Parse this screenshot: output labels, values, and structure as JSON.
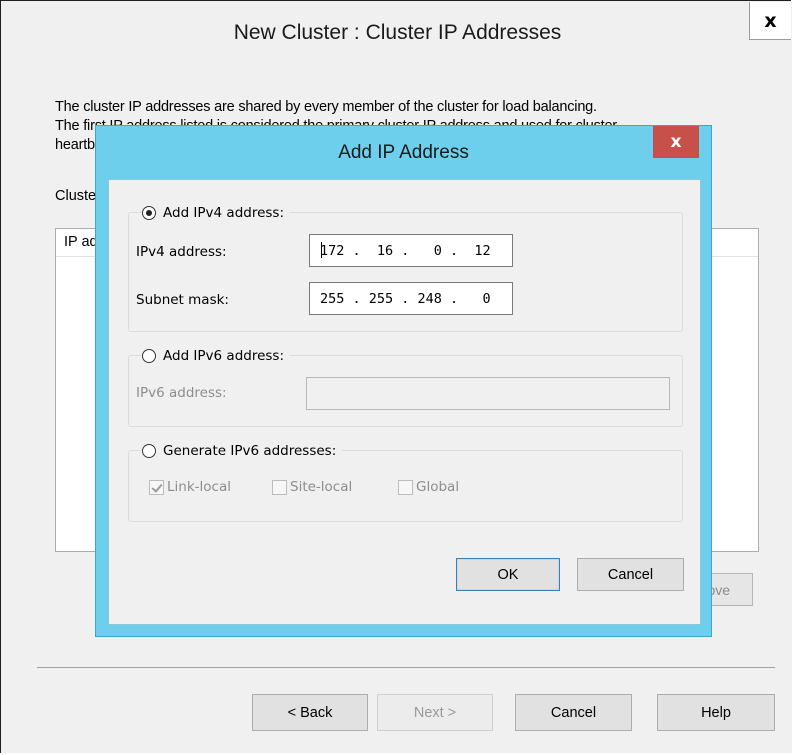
{
  "wizard": {
    "title": "New Cluster : Cluster IP Addresses",
    "close_glyph": "x",
    "description_lines": [
      "The cluster IP addresses are shared by every member of the cluster for load balancing.",
      "The first IP address listed is considered the primary cluster IP address and used for cluster",
      "heartbeats."
    ],
    "cluster_label": "Cluster IP addresses:",
    "list_column": "IP address",
    "remove_button": "Remove",
    "buttons": {
      "back": "< Back",
      "next": "Next >",
      "cancel": "Cancel",
      "help": "Help"
    }
  },
  "dialog": {
    "title": "Add IP Address",
    "close_glyph": "x",
    "ipv4": {
      "option_label": "Add IPv4 address:",
      "selected": true,
      "address_label": "IPv4 address:",
      "address_value": "172 .  16 .   0 .  12",
      "mask_label": "Subnet mask:",
      "mask_value": "255 . 255 . 248 .   0"
    },
    "ipv6": {
      "option_label": "Add IPv6 address:",
      "selected": false,
      "address_label": "IPv6 address:",
      "address_value": ""
    },
    "generate": {
      "option_label": "Generate IPv6 addresses:",
      "selected": false,
      "checkboxes": [
        {
          "label": "Link-local",
          "checked": true
        },
        {
          "label": "Site-local",
          "checked": false
        },
        {
          "label": "Global",
          "checked": false
        }
      ]
    },
    "buttons": {
      "ok": "OK",
      "cancel": "Cancel"
    }
  }
}
